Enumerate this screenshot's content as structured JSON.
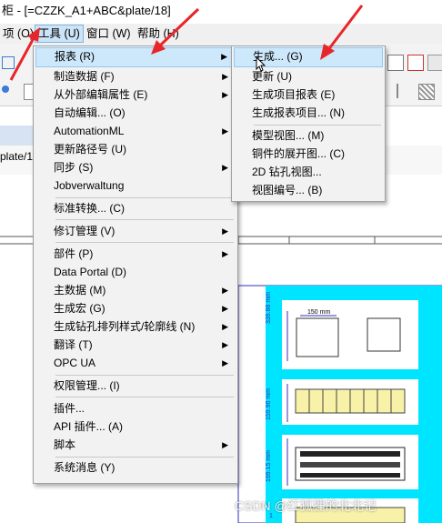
{
  "window": {
    "title": "柜 - [=CZZK_A1+ABC&plate/18]"
  },
  "menubar": {
    "items": [
      {
        "label": "项 (O)"
      },
      {
        "label": "工具 (U)"
      },
      {
        "label": "窗口 (W)"
      },
      {
        "label": "帮助 (H)"
      }
    ]
  },
  "document_tab": {
    "label": "plate/1"
  },
  "tools_menu": {
    "items": [
      {
        "label": "报表 (R)",
        "submenu": true
      },
      {
        "label": "制造数据 (F)",
        "submenu": true
      },
      {
        "label": "从外部编辑属性 (E)",
        "submenu": true
      },
      {
        "label": "自动编辑... (O)",
        "submenu": false
      },
      {
        "label": "AutomationML",
        "submenu": true
      },
      {
        "label": "更新路径号 (U)",
        "submenu": false
      },
      {
        "label": "同步 (S)",
        "submenu": true
      },
      {
        "label": "Jobverwaltung",
        "submenu": false
      },
      {
        "label": "标准转换... (C)",
        "submenu": false
      },
      {
        "label": "修订管理 (V)",
        "submenu": true
      },
      {
        "label": "部件 (P)",
        "submenu": true
      },
      {
        "label": "Data Portal (D)",
        "submenu": false
      },
      {
        "label": "主数据 (M)",
        "submenu": true
      },
      {
        "label": "生成宏 (G)",
        "submenu": true
      },
      {
        "label": "生成钻孔排列样式/轮廓线 (N)",
        "submenu": true
      },
      {
        "label": "翻译 (T)",
        "submenu": true
      },
      {
        "label": "OPC UA",
        "submenu": true
      },
      {
        "label": "权限管理... (I)",
        "submenu": false
      },
      {
        "label": "插件...",
        "submenu": false
      },
      {
        "label": "API 插件... (A)",
        "submenu": false
      },
      {
        "label": "脚本",
        "submenu": true
      },
      {
        "label": "系统消息 (Y)",
        "submenu": false
      }
    ]
  },
  "reports_submenu": {
    "items": [
      {
        "label": "生成... (G)"
      },
      {
        "label": "更新 (U)"
      },
      {
        "label": "生成项目报表 (E)"
      },
      {
        "label": "生成报表项目... (N)"
      },
      {
        "label": "模型视图... (M)"
      },
      {
        "label": "铜件的展开图... (C)"
      },
      {
        "label": "2D 钻孔视图..."
      },
      {
        "label": "视图编号... (B)"
      }
    ]
  },
  "drawing": {
    "dim_top": "150 mm",
    "dim_1": "339.88 mm",
    "dim_2": "159.96 mm",
    "dim_3": "199.15 mm",
    "dim_4": "1"
  },
  "watermark": "CSDN @红狐狸的北北记",
  "colors": {
    "accent": "#cde8fb",
    "annotation_arrow": "#e8262a",
    "drawing_cyan": "#00e5ff"
  }
}
